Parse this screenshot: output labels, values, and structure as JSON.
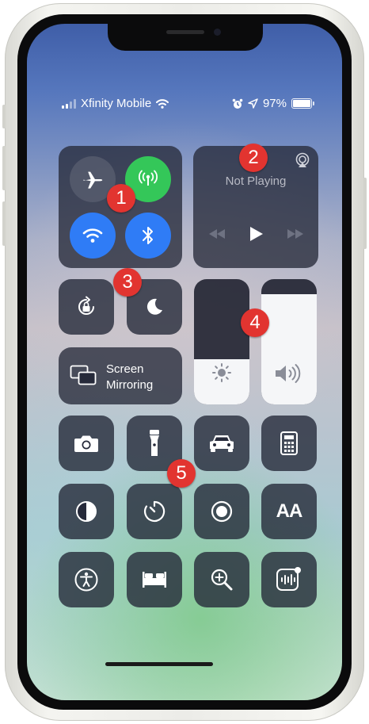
{
  "status_bar": {
    "carrier": "Xfinity Mobile",
    "battery_percent": "97%",
    "signal_bars": 2,
    "icons": [
      "signal-bars-icon",
      "wifi-icon",
      "alarm-icon",
      "location-arrow-icon",
      "battery-icon"
    ]
  },
  "connectivity": {
    "airplane_mode": {
      "icon": "airplane-icon",
      "on": false
    },
    "cellular_data": {
      "icon": "antenna-icon",
      "on": true,
      "color": "#34c759"
    },
    "wifi": {
      "icon": "wifi-icon",
      "on": true,
      "color": "#2f7cf6"
    },
    "bluetooth": {
      "icon": "bluetooth-icon",
      "on": true,
      "color": "#2f7cf6"
    }
  },
  "now_playing": {
    "title": "Not Playing",
    "icons": [
      "airplay-icon",
      "rewind-icon",
      "play-icon",
      "fast-forward-icon"
    ]
  },
  "toggles": {
    "orientation_lock": {
      "icon": "rotation-lock-icon"
    },
    "do_not_disturb": {
      "icon": "moon-icon"
    }
  },
  "screen_mirroring": {
    "line1": "Screen",
    "line2": "Mirroring",
    "icon": "screen-mirroring-icon"
  },
  "brightness": {
    "level": 0.36,
    "icon": "sun-icon"
  },
  "volume": {
    "level": 0.88,
    "icon": "speaker-volume-icon"
  },
  "controls": [
    {
      "name": "camera",
      "icon": "camera-icon"
    },
    {
      "name": "flashlight",
      "icon": "flashlight-icon"
    },
    {
      "name": "carplay",
      "icon": "car-icon"
    },
    {
      "name": "calculator",
      "icon": "calculator-icon"
    },
    {
      "name": "dark-mode",
      "icon": "dark-mode-icon"
    },
    {
      "name": "timer",
      "icon": "timer-icon"
    },
    {
      "name": "screen-recording",
      "icon": "record-icon"
    },
    {
      "name": "text-size",
      "icon": "text-size-icon",
      "label": "AA"
    },
    {
      "name": "accessibility",
      "icon": "accessibility-icon"
    },
    {
      "name": "sleep",
      "icon": "bed-icon"
    },
    {
      "name": "magnifier",
      "icon": "magnifier-icon"
    },
    {
      "name": "voice-memos",
      "icon": "voice-memo-icon"
    }
  ],
  "annotations": [
    "1",
    "2",
    "3",
    "4",
    "5"
  ],
  "colors": {
    "annotation": "#e23430",
    "green": "#34c759",
    "blue": "#2f7cf6"
  }
}
